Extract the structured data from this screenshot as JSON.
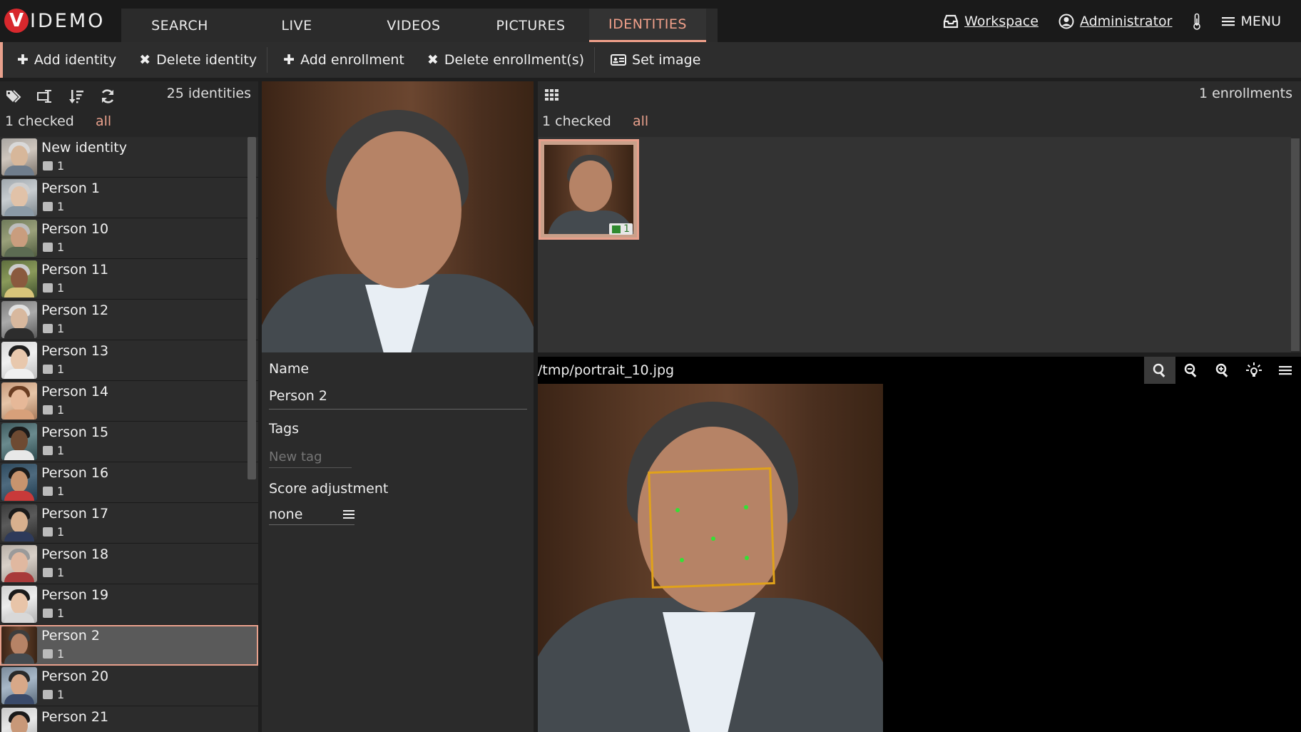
{
  "app": {
    "logo_mark": "V",
    "logo_text": "IDEMO"
  },
  "nav": {
    "tabs": [
      {
        "label": "SEARCH"
      },
      {
        "label": "LIVE"
      },
      {
        "label": "VIDEOS"
      },
      {
        "label": "PICTURES"
      },
      {
        "label": "IDENTITIES"
      }
    ],
    "active_tab": "IDENTITIES",
    "workspace_label": "Workspace",
    "user_label": "Administrator",
    "menu_label": "MENU"
  },
  "toolbar": {
    "add_identity": "Add identity",
    "delete_identity": "Delete identity",
    "add_enrollment": "Add enrollment",
    "delete_enrollments": "Delete enrollment(s)",
    "set_image": "Set image"
  },
  "identities_panel": {
    "count_text": "25 identities",
    "checked_text": "1 checked",
    "all_label": "all",
    "items": [
      {
        "name": "New identity",
        "enrollments": "1"
      },
      {
        "name": "Person 1",
        "enrollments": "1"
      },
      {
        "name": "Person 10",
        "enrollments": "1"
      },
      {
        "name": "Person 11",
        "enrollments": "1"
      },
      {
        "name": "Person 12",
        "enrollments": "1"
      },
      {
        "name": "Person 13",
        "enrollments": "1"
      },
      {
        "name": "Person 14",
        "enrollments": "1"
      },
      {
        "name": "Person 15",
        "enrollments": "1"
      },
      {
        "name": "Person 16",
        "enrollments": "1"
      },
      {
        "name": "Person 17",
        "enrollments": "1"
      },
      {
        "name": "Person 18",
        "enrollments": "1"
      },
      {
        "name": "Person 19",
        "enrollments": "1"
      },
      {
        "name": "Person 2",
        "enrollments": "1"
      },
      {
        "name": "Person 20",
        "enrollments": "1"
      },
      {
        "name": "Person 21",
        "enrollments": ""
      }
    ],
    "selected_name": "Person 2"
  },
  "details": {
    "name_label": "Name",
    "name_value": "Person 2",
    "tags_label": "Tags",
    "tag_placeholder": "New tag",
    "score_label": "Score adjustment",
    "score_value": "none"
  },
  "enrollments_panel": {
    "count_text": "1 enrollments",
    "checked_text": "1 checked",
    "all_label": "all",
    "tile_badge": "1"
  },
  "viewer": {
    "path": "/tmp/portrait_10.jpg"
  },
  "icons": {
    "tags": "tag-icon",
    "edit": "rename-icon",
    "sort": "sort-icon",
    "refresh": "refresh-icon",
    "grid": "grid-icon",
    "search": "search-icon",
    "zoom_out": "zoom-out-icon",
    "zoom_in": "zoom-in-icon",
    "brightness": "brightness-icon",
    "menu": "menu-icon"
  },
  "colors": {
    "accent": "#e8a08c",
    "brand_red": "#d8282d",
    "facebox": "#e0a21a",
    "landmark": "#35e035"
  }
}
